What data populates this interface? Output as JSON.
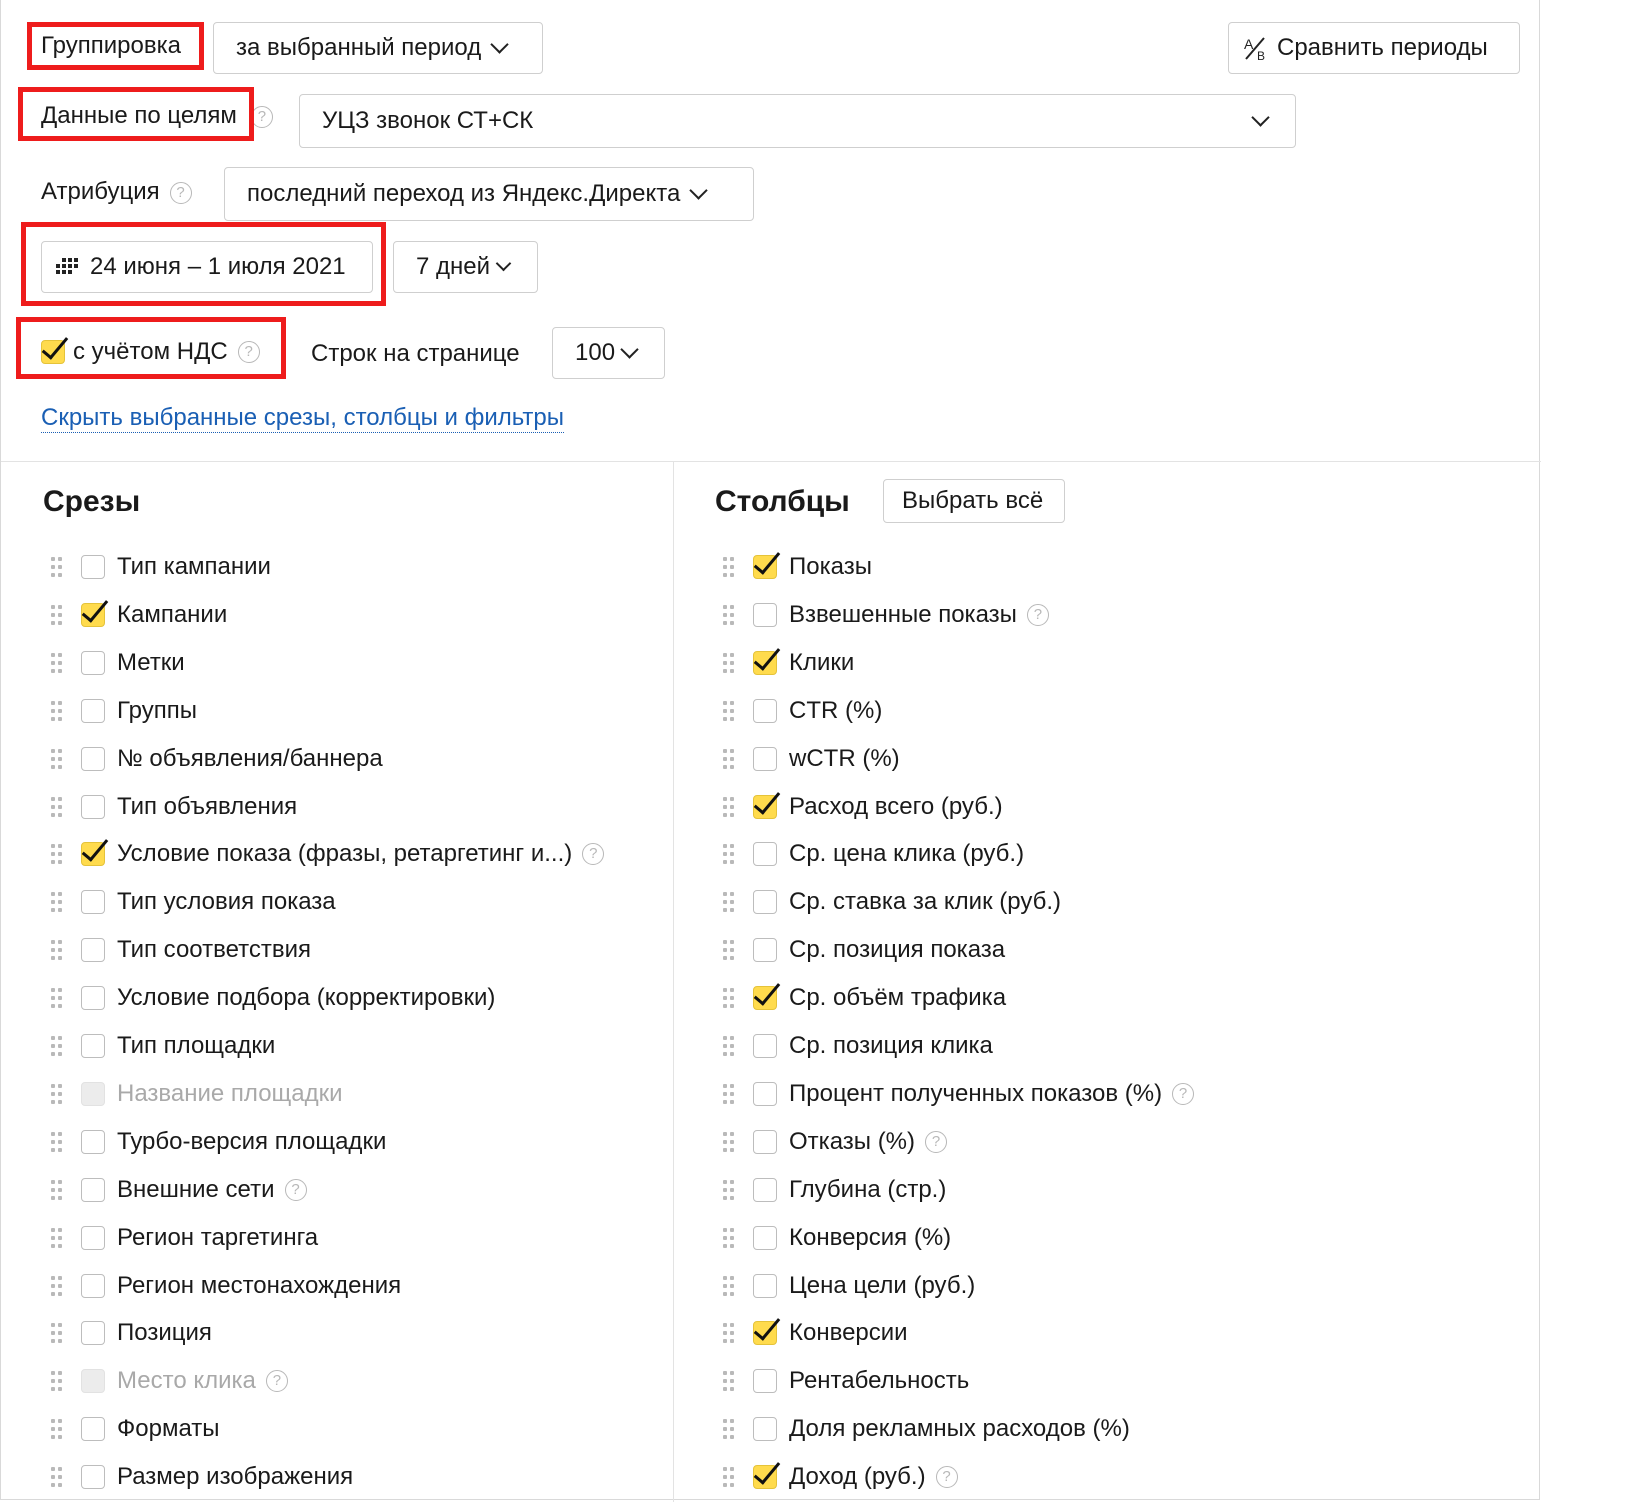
{
  "toolbar": {
    "grouping_label": "Группировка",
    "grouping_value": "за выбранный период",
    "compare_button": "Сравнить периоды",
    "compare_icon": "ab-compare-icon",
    "goals_label": "Данные по целям",
    "goals_value": "УЦЗ звонок СТ+СК",
    "attribution_label": "Атрибуция",
    "attribution_value": "последний переход из Яндекс.Директа",
    "date_range": "24 июня – 1 июля 2021",
    "calendar_icon": "calendar-icon",
    "period_value": "7 дней",
    "vat_label": "с учётом НДС",
    "vat_checked": true,
    "rows_label": "Строк на странице",
    "rows_value": "100",
    "hide_link": "Скрыть выбранные срезы, столбцы и фильтры",
    "help_glyph": "?"
  },
  "slices": {
    "title": "Срезы",
    "items": [
      {
        "label": "Тип кампании",
        "checked": false,
        "disabled": false,
        "help": false
      },
      {
        "label": "Кампании",
        "checked": true,
        "disabled": false,
        "help": false
      },
      {
        "label": "Метки",
        "checked": false,
        "disabled": false,
        "help": false
      },
      {
        "label": "Группы",
        "checked": false,
        "disabled": false,
        "help": false
      },
      {
        "label": "№ объявления/баннера",
        "checked": false,
        "disabled": false,
        "help": false
      },
      {
        "label": "Тип объявления",
        "checked": false,
        "disabled": false,
        "help": false
      },
      {
        "label": "Условие показа (фразы, ретаргетинг и...)",
        "checked": true,
        "disabled": false,
        "help": true
      },
      {
        "label": "Тип условия показа",
        "checked": false,
        "disabled": false,
        "help": false
      },
      {
        "label": "Тип соответствия",
        "checked": false,
        "disabled": false,
        "help": false
      },
      {
        "label": "Условие подбора (корректировки)",
        "checked": false,
        "disabled": false,
        "help": false
      },
      {
        "label": "Тип площадки",
        "checked": false,
        "disabled": false,
        "help": false
      },
      {
        "label": "Название площадки",
        "checked": false,
        "disabled": true,
        "help": false
      },
      {
        "label": "Турбо-версия площадки",
        "checked": false,
        "disabled": false,
        "help": false
      },
      {
        "label": "Внешние сети",
        "checked": false,
        "disabled": false,
        "help": true
      },
      {
        "label": "Регион таргетинга",
        "checked": false,
        "disabled": false,
        "help": false
      },
      {
        "label": "Регион местонахождения",
        "checked": false,
        "disabled": false,
        "help": false
      },
      {
        "label": "Позиция",
        "checked": false,
        "disabled": false,
        "help": false
      },
      {
        "label": "Место клика",
        "checked": false,
        "disabled": true,
        "help": true
      },
      {
        "label": "Форматы",
        "checked": false,
        "disabled": false,
        "help": false
      },
      {
        "label": "Размер изображения",
        "checked": false,
        "disabled": false,
        "help": false
      }
    ]
  },
  "columns": {
    "title": "Столбцы",
    "select_all": "Выбрать всё",
    "items": [
      {
        "label": "Показы",
        "checked": true,
        "help": false
      },
      {
        "label": "Взвешенные показы",
        "checked": false,
        "help": true
      },
      {
        "label": "Клики",
        "checked": true,
        "help": false
      },
      {
        "label": "CTR (%)",
        "checked": false,
        "help": false
      },
      {
        "label": "wCTR (%)",
        "checked": false,
        "help": false
      },
      {
        "label": "Расход всего (руб.)",
        "checked": true,
        "help": false
      },
      {
        "label": "Ср. цена клика (руб.)",
        "checked": false,
        "help": false
      },
      {
        "label": "Ср. ставка за клик (руб.)",
        "checked": false,
        "help": false
      },
      {
        "label": "Ср. позиция показа",
        "checked": false,
        "help": false
      },
      {
        "label": "Ср. объём трафика",
        "checked": true,
        "help": false
      },
      {
        "label": "Ср. позиция клика",
        "checked": false,
        "help": false
      },
      {
        "label": "Процент полученных показов (%)",
        "checked": false,
        "help": true
      },
      {
        "label": "Отказы (%)",
        "checked": false,
        "help": true
      },
      {
        "label": "Глубина (стр.)",
        "checked": false,
        "help": false
      },
      {
        "label": "Конверсия (%)",
        "checked": false,
        "help": false
      },
      {
        "label": "Цена цели (руб.)",
        "checked": false,
        "help": false
      },
      {
        "label": "Конверсии",
        "checked": true,
        "help": false
      },
      {
        "label": "Рентабельность",
        "checked": false,
        "help": false
      },
      {
        "label": "Доля рекламных расходов (%)",
        "checked": false,
        "help": false
      },
      {
        "label": "Доход (руб.)",
        "checked": true,
        "help": true
      }
    ]
  },
  "colors": {
    "checkbox_checked": "#ffdb4d",
    "highlight_box": "#ee1c1c",
    "link": "#1a5fb4"
  }
}
